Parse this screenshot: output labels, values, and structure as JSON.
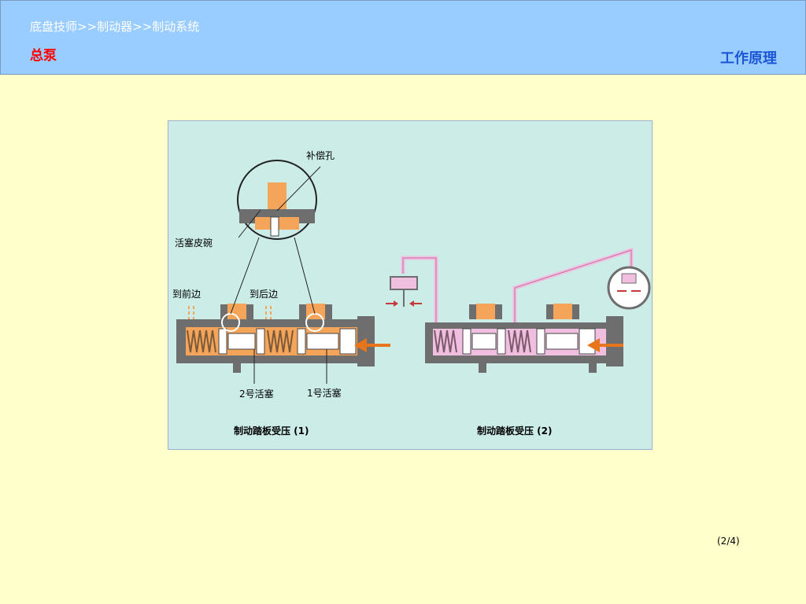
{
  "header": {
    "breadcrumb": "底盘技师>>制动器>>制动系统",
    "section": "总泵",
    "topic": "工作原理"
  },
  "figure": {
    "labels": {
      "compensation_hole": "补偿孔",
      "piston_cup": "活塞皮碗",
      "to_front": "到前边",
      "to_rear": "到后边",
      "piston_2": "2号活塞",
      "piston_1": "1号活塞"
    },
    "captions": {
      "left": "制动踏板受压  (1)",
      "right": "制动踏板受压  (2)"
    },
    "colors": {
      "background": "#ccece8",
      "housing": "#6e6e6e",
      "fluid": "#f5a55a",
      "pressurized_fluid": "#f0bfe0",
      "arrow": "#e8751a"
    }
  },
  "footer": {
    "page_indicator": "(2/4)"
  }
}
